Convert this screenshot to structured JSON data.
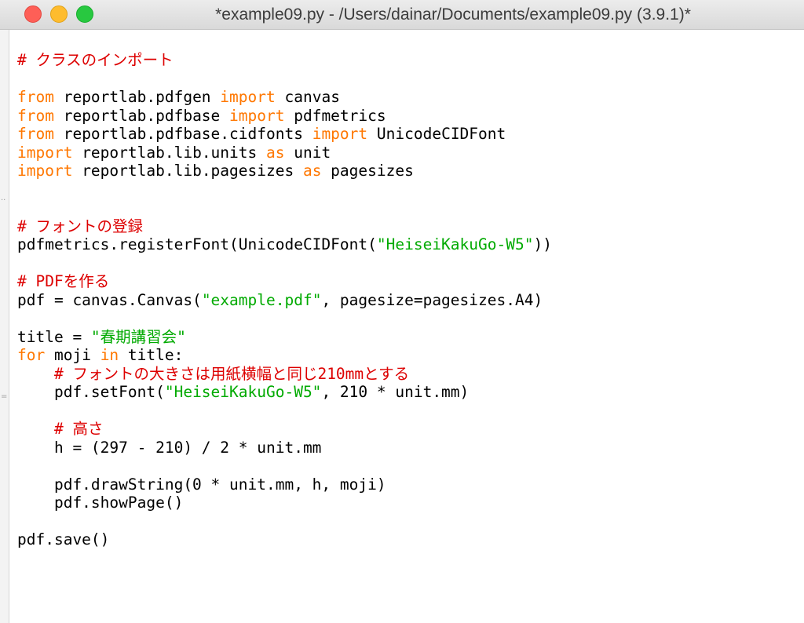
{
  "window": {
    "title": "*example09.py - /Users/dainar/Documents/example09.py (3.9.1)*"
  },
  "gutter": {
    "mark_1": "··",
    "mark_2": "="
  },
  "colors": {
    "keyword": "#ff7700",
    "string": "#00aa00",
    "comment": "#dd0000",
    "default": "#000000"
  },
  "editor": {
    "lines": [
      [
        {
          "t": "# クラスのインポート",
          "c": "cmt"
        }
      ],
      [],
      [
        {
          "t": "from",
          "c": "kw"
        },
        {
          "t": " reportlab.pdfgen ",
          "c": "plain"
        },
        {
          "t": "import",
          "c": "kw"
        },
        {
          "t": " canvas",
          "c": "plain"
        }
      ],
      [
        {
          "t": "from",
          "c": "kw"
        },
        {
          "t": " reportlab.pdfbase ",
          "c": "plain"
        },
        {
          "t": "import",
          "c": "kw"
        },
        {
          "t": " pdfmetrics",
          "c": "plain"
        }
      ],
      [
        {
          "t": "from",
          "c": "kw"
        },
        {
          "t": " reportlab.pdfbase.cidfonts ",
          "c": "plain"
        },
        {
          "t": "import",
          "c": "kw"
        },
        {
          "t": " UnicodeCIDFont",
          "c": "plain"
        }
      ],
      [
        {
          "t": "import",
          "c": "kw"
        },
        {
          "t": " reportlab.lib.units ",
          "c": "plain"
        },
        {
          "t": "as",
          "c": "kw"
        },
        {
          "t": " unit",
          "c": "plain"
        }
      ],
      [
        {
          "t": "import",
          "c": "kw"
        },
        {
          "t": " reportlab.lib.pagesizes ",
          "c": "plain"
        },
        {
          "t": "as",
          "c": "kw"
        },
        {
          "t": " pagesizes",
          "c": "plain"
        }
      ],
      [],
      [],
      [
        {
          "t": "# フォントの登録",
          "c": "cmt"
        }
      ],
      [
        {
          "t": "pdfmetrics.registerFont(UnicodeCIDFont(",
          "c": "plain"
        },
        {
          "t": "\"HeiseiKakuGo-W5\"",
          "c": "str"
        },
        {
          "t": "))",
          "c": "plain"
        }
      ],
      [],
      [
        {
          "t": "# PDFを作る",
          "c": "cmt"
        }
      ],
      [
        {
          "t": "pdf = canvas.Canvas(",
          "c": "plain"
        },
        {
          "t": "\"example.pdf\"",
          "c": "str"
        },
        {
          "t": ", pagesize=pagesizes.A4)",
          "c": "plain"
        }
      ],
      [],
      [
        {
          "t": "title = ",
          "c": "plain"
        },
        {
          "t": "\"春期講習会\"",
          "c": "str"
        }
      ],
      [
        {
          "t": "for",
          "c": "kw"
        },
        {
          "t": " moji ",
          "c": "plain"
        },
        {
          "t": "in",
          "c": "kw"
        },
        {
          "t": " title:",
          "c": "plain"
        }
      ],
      [
        {
          "t": "    ",
          "c": "plain"
        },
        {
          "t": "# フォントの大きさは用紙横幅と同じ210mmとする",
          "c": "cmt"
        }
      ],
      [
        {
          "t": "    pdf.setFont(",
          "c": "plain"
        },
        {
          "t": "\"HeiseiKakuGo-W5\"",
          "c": "str"
        },
        {
          "t": ", 210 * unit.mm)",
          "c": "plain"
        }
      ],
      [],
      [
        {
          "t": "    ",
          "c": "plain"
        },
        {
          "t": "# 高さ",
          "c": "cmt"
        }
      ],
      [
        {
          "t": "    h = (297 - 210) / 2 * unit.mm",
          "c": "plain"
        }
      ],
      [],
      [
        {
          "t": "    pdf.drawString(0 * unit.mm, h, moji)",
          "c": "plain"
        }
      ],
      [
        {
          "t": "    pdf.showPage()",
          "c": "plain"
        }
      ],
      [],
      [
        {
          "t": "pdf.save()",
          "c": "plain"
        }
      ]
    ]
  }
}
